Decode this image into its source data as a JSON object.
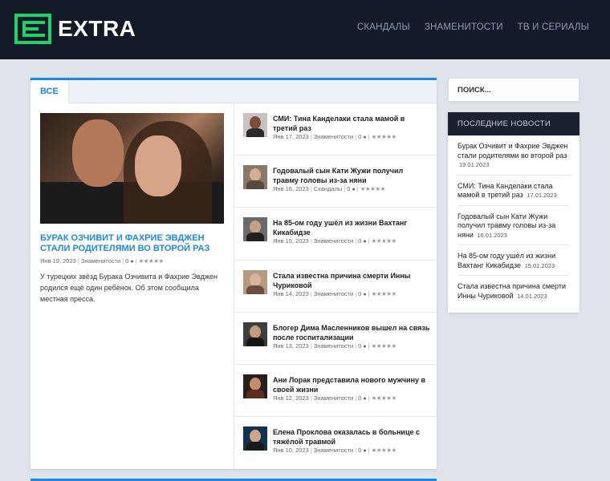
{
  "site": {
    "logo_letter": "E",
    "logo_text": "EXTRA",
    "brand_color": "#1fd36a",
    "accent_color": "#1e88e5"
  },
  "nav": [
    {
      "label": "СКАНДАЛЫ"
    },
    {
      "label": "ЗНАМЕНИТОСТИ"
    },
    {
      "label": "ТВ И СЕРИАЛЫ"
    }
  ],
  "main": {
    "tab_label": "ВСЕ",
    "feature": {
      "title": "Бурак Озчивит и Фахрие Эвджен стали родителями во второй раз",
      "date": "Янв 19, 2023",
      "category": "Знаменитости",
      "comments": "0",
      "excerpt": "У турецких звёзд Бурака Озчивита и Фахрие Эвджен родился ещё один ребёнок. Об этом сообщила местная пресса."
    },
    "items": [
      {
        "title": "СМИ: Тина Канделаки стала мамой в третий раз",
        "date": "Янв 17, 2023",
        "category": "Знаменитости",
        "comments": "0",
        "thumb_bg": "#c9c2c0",
        "thumb_face": "#7a4d3b",
        "thumb_body": "#2a2a2a"
      },
      {
        "title": "Годовалый сын Кати Жужи получил травму головы из-за няни",
        "date": "Янв 16, 2023",
        "category": "Скандалы",
        "comments": "0",
        "thumb_bg": "#8a7868",
        "thumb_face": "#d4ae92",
        "thumb_body": "#5a4a3e"
      },
      {
        "title": "На 85-ом году ушёл из жизни Вахтанг Кикабидзе",
        "date": "Янв 15, 2023",
        "category": "Знаменитости",
        "comments": "0",
        "thumb_bg": "#6b6b6b",
        "thumb_face": "#c7a089",
        "thumb_body": "#1f1f1f"
      },
      {
        "title": "Стала известна причина смерти Инны Чуриковой",
        "date": "Янв 14, 2023",
        "category": "Знаменитости",
        "comments": "0",
        "thumb_bg": "#b59a80",
        "thumb_face": "#d9b49a",
        "thumb_body": "#6e5040"
      },
      {
        "title": "Блогер Дима Масленников вышел на связь после госпитализации",
        "date": "Янв 13, 2023",
        "category": "Знаменитости",
        "comments": "0",
        "thumb_bg": "#3d3d3d",
        "thumb_face": "#bf9b80",
        "thumb_body": "#151515"
      },
      {
        "title": "Ани Лорак представила нового мужчину в своей жизни",
        "date": "Янв 12, 2023",
        "category": "Знаменитости",
        "comments": "0",
        "thumb_bg": "#2a1e1a",
        "thumb_face": "#c48d6c",
        "thumb_body": "#5e2c1e"
      },
      {
        "title": "Елена Проклова оказалась в больнице с тяжёлой травмой",
        "date": "Янв 10, 2023",
        "category": "Знаменитости",
        "comments": "0",
        "thumb_bg": "#12324f",
        "thumb_face": "#d0a68a",
        "thumb_body": "#1a1a1a"
      }
    ]
  },
  "sidebar": {
    "search_placeholder": "ПОИСК...",
    "widget_title": "ПОСЛЕДНИЕ НОВОСТИ",
    "news": [
      {
        "title": "Бурак Озчивит и Фахрие Эвджен стали родителями во второй раз",
        "date": "19.01.2023"
      },
      {
        "title": "СМИ: Тина Канделаки стала мамой в третий раз",
        "date": "17.01.2023"
      },
      {
        "title": "Годовалый сын Кати Жужи получил травму головы из-за няни",
        "date": "16.01.2023"
      },
      {
        "title": "На 85-ом году ушёл из жизни Вахтанг Кикабидзе",
        "date": "15.01.2023"
      },
      {
        "title": "Стала известна причина смерти Инны Чуриковой",
        "date": "14.01.2023"
      }
    ]
  }
}
